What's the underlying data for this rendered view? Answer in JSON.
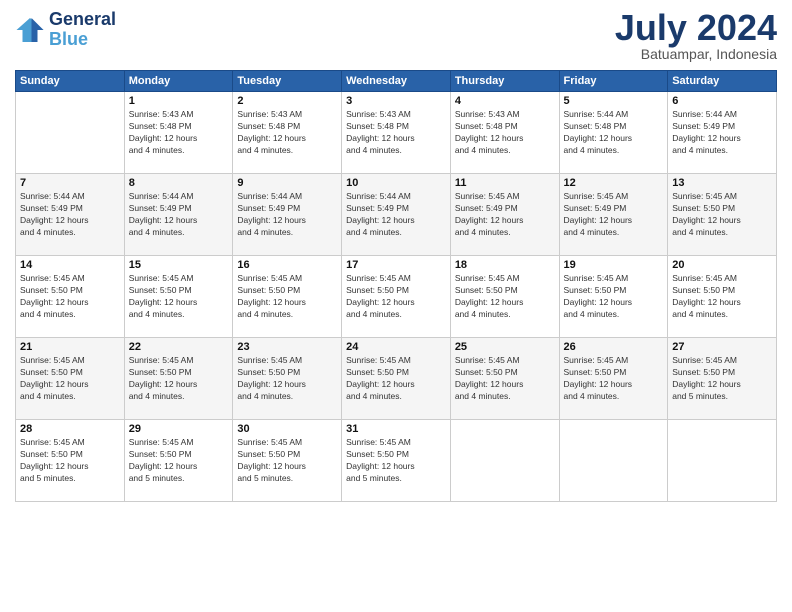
{
  "logo": {
    "text_general": "General",
    "text_blue": "Blue"
  },
  "header": {
    "month_year": "July 2024",
    "location": "Batuampar, Indonesia"
  },
  "weekdays": [
    "Sunday",
    "Monday",
    "Tuesday",
    "Wednesday",
    "Thursday",
    "Friday",
    "Saturday"
  ],
  "weeks": [
    [
      {
        "day": "",
        "info": ""
      },
      {
        "day": "1",
        "info": "Sunrise: 5:43 AM\nSunset: 5:48 PM\nDaylight: 12 hours\nand 4 minutes."
      },
      {
        "day": "2",
        "info": "Sunrise: 5:43 AM\nSunset: 5:48 PM\nDaylight: 12 hours\nand 4 minutes."
      },
      {
        "day": "3",
        "info": "Sunrise: 5:43 AM\nSunset: 5:48 PM\nDaylight: 12 hours\nand 4 minutes."
      },
      {
        "day": "4",
        "info": "Sunrise: 5:43 AM\nSunset: 5:48 PM\nDaylight: 12 hours\nand 4 minutes."
      },
      {
        "day": "5",
        "info": "Sunrise: 5:44 AM\nSunset: 5:48 PM\nDaylight: 12 hours\nand 4 minutes."
      },
      {
        "day": "6",
        "info": "Sunrise: 5:44 AM\nSunset: 5:49 PM\nDaylight: 12 hours\nand 4 minutes."
      }
    ],
    [
      {
        "day": "7",
        "info": "Sunrise: 5:44 AM\nSunset: 5:49 PM\nDaylight: 12 hours\nand 4 minutes."
      },
      {
        "day": "8",
        "info": "Sunrise: 5:44 AM\nSunset: 5:49 PM\nDaylight: 12 hours\nand 4 minutes."
      },
      {
        "day": "9",
        "info": "Sunrise: 5:44 AM\nSunset: 5:49 PM\nDaylight: 12 hours\nand 4 minutes."
      },
      {
        "day": "10",
        "info": "Sunrise: 5:44 AM\nSunset: 5:49 PM\nDaylight: 12 hours\nand 4 minutes."
      },
      {
        "day": "11",
        "info": "Sunrise: 5:45 AM\nSunset: 5:49 PM\nDaylight: 12 hours\nand 4 minutes."
      },
      {
        "day": "12",
        "info": "Sunrise: 5:45 AM\nSunset: 5:49 PM\nDaylight: 12 hours\nand 4 minutes."
      },
      {
        "day": "13",
        "info": "Sunrise: 5:45 AM\nSunset: 5:50 PM\nDaylight: 12 hours\nand 4 minutes."
      }
    ],
    [
      {
        "day": "14",
        "info": "Sunrise: 5:45 AM\nSunset: 5:50 PM\nDaylight: 12 hours\nand 4 minutes."
      },
      {
        "day": "15",
        "info": "Sunrise: 5:45 AM\nSunset: 5:50 PM\nDaylight: 12 hours\nand 4 minutes."
      },
      {
        "day": "16",
        "info": "Sunrise: 5:45 AM\nSunset: 5:50 PM\nDaylight: 12 hours\nand 4 minutes."
      },
      {
        "day": "17",
        "info": "Sunrise: 5:45 AM\nSunset: 5:50 PM\nDaylight: 12 hours\nand 4 minutes."
      },
      {
        "day": "18",
        "info": "Sunrise: 5:45 AM\nSunset: 5:50 PM\nDaylight: 12 hours\nand 4 minutes."
      },
      {
        "day": "19",
        "info": "Sunrise: 5:45 AM\nSunset: 5:50 PM\nDaylight: 12 hours\nand 4 minutes."
      },
      {
        "day": "20",
        "info": "Sunrise: 5:45 AM\nSunset: 5:50 PM\nDaylight: 12 hours\nand 4 minutes."
      }
    ],
    [
      {
        "day": "21",
        "info": "Sunrise: 5:45 AM\nSunset: 5:50 PM\nDaylight: 12 hours\nand 4 minutes."
      },
      {
        "day": "22",
        "info": "Sunrise: 5:45 AM\nSunset: 5:50 PM\nDaylight: 12 hours\nand 4 minutes."
      },
      {
        "day": "23",
        "info": "Sunrise: 5:45 AM\nSunset: 5:50 PM\nDaylight: 12 hours\nand 4 minutes."
      },
      {
        "day": "24",
        "info": "Sunrise: 5:45 AM\nSunset: 5:50 PM\nDaylight: 12 hours\nand 4 minutes."
      },
      {
        "day": "25",
        "info": "Sunrise: 5:45 AM\nSunset: 5:50 PM\nDaylight: 12 hours\nand 4 minutes."
      },
      {
        "day": "26",
        "info": "Sunrise: 5:45 AM\nSunset: 5:50 PM\nDaylight: 12 hours\nand 4 minutes."
      },
      {
        "day": "27",
        "info": "Sunrise: 5:45 AM\nSunset: 5:50 PM\nDaylight: 12 hours\nand 5 minutes."
      }
    ],
    [
      {
        "day": "28",
        "info": "Sunrise: 5:45 AM\nSunset: 5:50 PM\nDaylight: 12 hours\nand 5 minutes."
      },
      {
        "day": "29",
        "info": "Sunrise: 5:45 AM\nSunset: 5:50 PM\nDaylight: 12 hours\nand 5 minutes."
      },
      {
        "day": "30",
        "info": "Sunrise: 5:45 AM\nSunset: 5:50 PM\nDaylight: 12 hours\nand 5 minutes."
      },
      {
        "day": "31",
        "info": "Sunrise: 5:45 AM\nSunset: 5:50 PM\nDaylight: 12 hours\nand 5 minutes."
      },
      {
        "day": "",
        "info": ""
      },
      {
        "day": "",
        "info": ""
      },
      {
        "day": "",
        "info": ""
      }
    ]
  ]
}
